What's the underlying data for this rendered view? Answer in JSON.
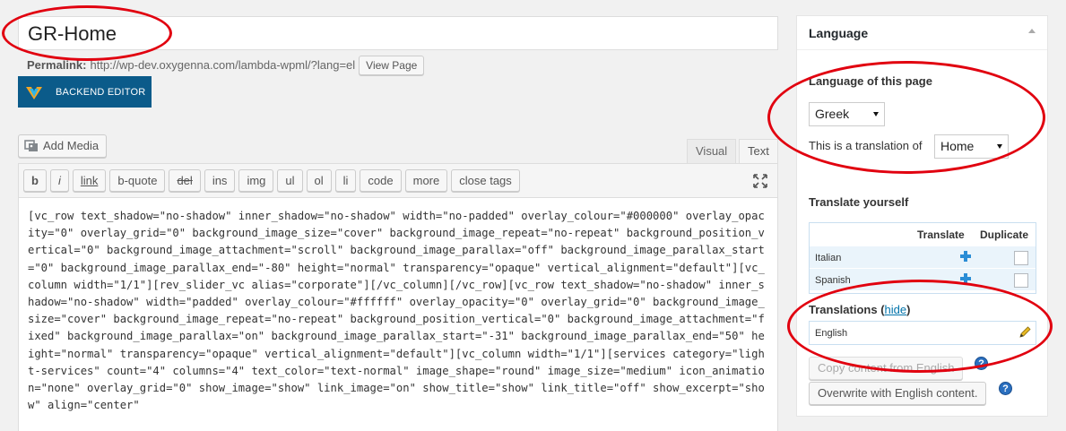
{
  "post": {
    "title": "GR-Home",
    "permalink_label": "Permalink:",
    "permalink_url": "http://wp-dev.oxygenna.com/lambda-wpml/?lang=el",
    "view_page_label": "View Page"
  },
  "editor": {
    "backend_editor_label": "BACKEND EDITOR",
    "add_media_label": "Add Media",
    "tabs": {
      "visual": "Visual",
      "text": "Text"
    },
    "quicktags": [
      "b",
      "i",
      "link",
      "b-quote",
      "del",
      "ins",
      "img",
      "ul",
      "ol",
      "li",
      "code",
      "more",
      "close tags"
    ],
    "content": "[vc_row text_shadow=\"no-shadow\" inner_shadow=\"no-shadow\" width=\"no-padded\" overlay_colour=\"#000000\" overlay_opacity=\"0\" overlay_grid=\"0\" background_image_size=\"cover\" background_image_repeat=\"no-repeat\" background_position_vertical=\"0\" background_image_attachment=\"scroll\" background_image_parallax=\"off\" background_image_parallax_start=\"0\" background_image_parallax_end=\"-80\" height=\"normal\" transparency=\"opaque\" vertical_alignment=\"default\"][vc_column width=\"1/1\"][rev_slider_vc alias=\"corporate\"][/vc_column][/vc_row][vc_row text_shadow=\"no-shadow\" inner_shadow=\"no-shadow\" width=\"padded\" overlay_colour=\"#ffffff\" overlay_opacity=\"0\" overlay_grid=\"0\" background_image_size=\"cover\" background_image_repeat=\"no-repeat\" background_position_vertical=\"0\" background_image_attachment=\"fixed\" background_image_parallax=\"on\" background_image_parallax_start=\"-31\" background_image_parallax_end=\"50\" height=\"normal\" transparency=\"opaque\" vertical_alignment=\"default\"][vc_column width=\"1/1\"][services category=\"light-services\" count=\"4\" columns=\"4\" text_color=\"text-normal\" image_shape=\"round\" image_size=\"medium\" icon_animation=\"none\" overlay_grid=\"0\" show_image=\"show\" link_image=\"on\" show_title=\"show\" link_title=\"off\" show_excerpt=\"show\" align=\"center\""
  },
  "language_box": {
    "title": "Language",
    "language_of_page_label": "Language of this page",
    "language_selected": "Greek",
    "translation_of_label": "This is a translation of",
    "translation_of_selected": "Home",
    "translate_yourself_label": "Translate yourself",
    "table_headers": {
      "translate": "Translate",
      "duplicate": "Duplicate"
    },
    "rows": [
      {
        "language": "Italian"
      },
      {
        "language": "Spanish"
      }
    ],
    "translations_label": "Translations",
    "hide_link": "hide",
    "translations": [
      {
        "language": "English"
      }
    ],
    "copy_button": "Copy content from English",
    "overwrite_button": "Overwrite with English content."
  },
  "colors": {
    "annotation": "#e1000f",
    "backend_editor_bg": "#0b5b8a",
    "link": "#0073aa"
  }
}
